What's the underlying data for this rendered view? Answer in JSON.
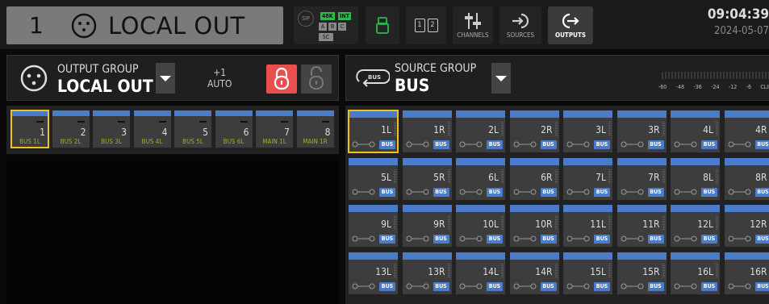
{
  "header": {
    "channel_number": "1",
    "channel_name": "LOCAL OUT",
    "sync": {
      "sip_label": "SIP",
      "rate": "48K",
      "int": "INT",
      "abc": [
        "A",
        "B",
        "C"
      ],
      "sc": "SC"
    },
    "buttons": {
      "channels": "CHANNELS",
      "sources": "SOURCES",
      "outputs": "OUTPUTS"
    },
    "page_numbers": [
      "1",
      "2"
    ],
    "time": "09:04:39",
    "date": "2024-05-07"
  },
  "output_group": {
    "label": "OUTPUT GROUP",
    "name": "LOCAL OUT",
    "offset": "+1",
    "mode": "AUTO"
  },
  "source_group": {
    "label": "SOURCE GROUP",
    "name": "BUS",
    "bus_icon_text": "BUS",
    "meter_ticks": [
      "-60",
      "-48",
      "-36",
      "-24",
      "-12",
      "-6",
      "CLIP"
    ]
  },
  "outputs": [
    {
      "num": "1",
      "label": "BUS 1L",
      "selected": true
    },
    {
      "num": "2",
      "label": "BUS 2L",
      "selected": false
    },
    {
      "num": "3",
      "label": "BUS 3L",
      "selected": false
    },
    {
      "num": "4",
      "label": "BUS 4L",
      "selected": false
    },
    {
      "num": "5",
      "label": "BUS 5L",
      "selected": false
    },
    {
      "num": "6",
      "label": "BUS 6L",
      "selected": false
    },
    {
      "num": "7",
      "label": "MAIN 1L",
      "selected": false
    },
    {
      "num": "8",
      "label": "MAIN 1R",
      "selected": false
    }
  ],
  "sources": [
    {
      "label": "1L",
      "tag": "BUS",
      "selected": true
    },
    {
      "label": "1R",
      "tag": "BUS"
    },
    {
      "label": "2L",
      "tag": "BUS"
    },
    {
      "label": "2R",
      "tag": "BUS"
    },
    {
      "label": "3L",
      "tag": "BUS"
    },
    {
      "label": "3R",
      "tag": "BUS"
    },
    {
      "label": "4L",
      "tag": "BUS"
    },
    {
      "label": "4R",
      "tag": "BUS"
    },
    {
      "label": "5L",
      "tag": "BUS"
    },
    {
      "label": "5R",
      "tag": "BUS"
    },
    {
      "label": "6L",
      "tag": "BUS"
    },
    {
      "label": "6R",
      "tag": "BUS"
    },
    {
      "label": "7L",
      "tag": "BUS"
    },
    {
      "label": "7R",
      "tag": "BUS"
    },
    {
      "label": "8L",
      "tag": "BUS"
    },
    {
      "label": "8R",
      "tag": "BUS"
    },
    {
      "label": "9L",
      "tag": "BUS"
    },
    {
      "label": "9R",
      "tag": "BUS"
    },
    {
      "label": "10L",
      "tag": "BUS"
    },
    {
      "label": "10R",
      "tag": "BUS"
    },
    {
      "label": "11L",
      "tag": "BUS"
    },
    {
      "label": "11R",
      "tag": "BUS"
    },
    {
      "label": "12L",
      "tag": "BUS"
    },
    {
      "label": "12R",
      "tag": "BUS"
    },
    {
      "label": "13L",
      "tag": "BUS"
    },
    {
      "label": "13R",
      "tag": "BUS"
    },
    {
      "label": "14L",
      "tag": "BUS"
    },
    {
      "label": "14R",
      "tag": "BUS"
    },
    {
      "label": "15L",
      "tag": "BUS"
    },
    {
      "label": "15R",
      "tag": "BUS"
    },
    {
      "label": "16L",
      "tag": "BUS"
    },
    {
      "label": "16R",
      "tag": "BUS"
    }
  ],
  "colors": {
    "accent_blue": "#4a7cc9",
    "select_yellow": "#f0c21b",
    "lock_red": "#e94f4f",
    "sync_green": "#2fb84a",
    "output_label_green": "#9ab030"
  }
}
